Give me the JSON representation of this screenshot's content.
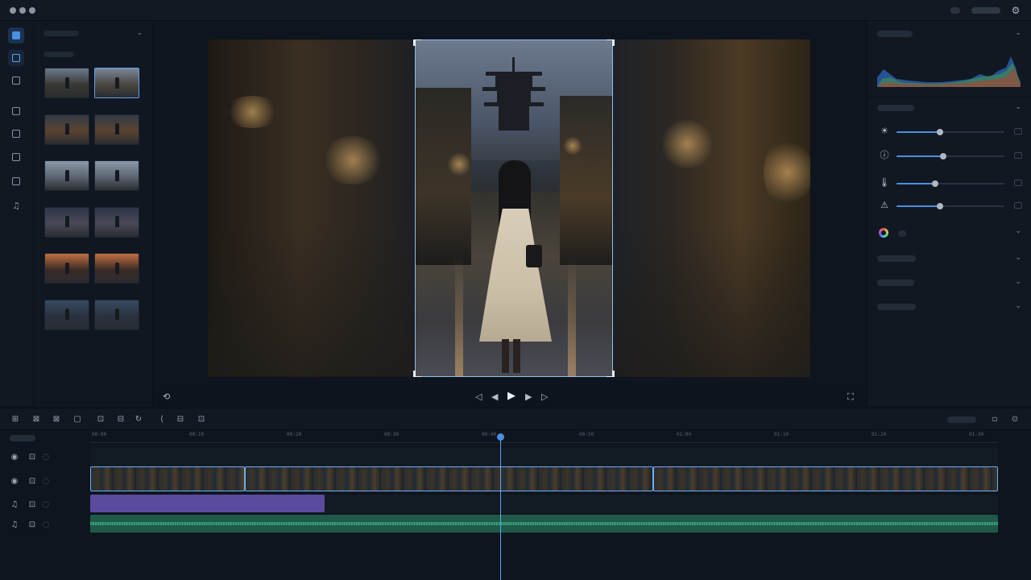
{
  "window": {
    "traffic_lights": [
      "close",
      "minimize",
      "maximize"
    ],
    "top_right_icon": "gear-icon"
  },
  "rail": {
    "items": [
      {
        "name": "media-icon",
        "active": true
      },
      {
        "name": "project-icon",
        "active": false
      },
      {
        "name": "text-icon",
        "active": false
      },
      {
        "name": "effects-icon",
        "active": false
      },
      {
        "name": "transitions-icon",
        "active": false
      },
      {
        "name": "stickers-icon",
        "active": false
      },
      {
        "name": "templates-icon",
        "active": false
      },
      {
        "name": "music-icon",
        "active": false
      }
    ]
  },
  "media_panel": {
    "thumbnails": [
      {
        "scene": "street-dusk",
        "selected": false
      },
      {
        "scene": "woman-walking",
        "selected": true
      },
      {
        "scene": "street-lights",
        "selected": false
      },
      {
        "scene": "street-lights",
        "selected": false
      },
      {
        "scene": "street-rain",
        "selected": false
      },
      {
        "scene": "street-rain",
        "selected": false
      },
      {
        "scene": "street-night",
        "selected": false
      },
      {
        "scene": "street-night",
        "selected": false
      },
      {
        "scene": "sunset-street",
        "selected": false
      },
      {
        "scene": "sunset-street",
        "selected": false
      },
      {
        "scene": "night-figure",
        "selected": false
      },
      {
        "scene": "night-figure",
        "selected": false
      }
    ]
  },
  "viewer": {
    "controls": {
      "prev_frame": "◁",
      "step_back": "◀",
      "play": "▶",
      "step_forward": "▶",
      "next_frame": "▷"
    }
  },
  "properties": {
    "sliders": [
      {
        "name": "brightness",
        "icon": "☀",
        "value": 0.4
      },
      {
        "name": "contrast",
        "icon": "ⓘ",
        "value": 0.43
      },
      {
        "name": "temperature",
        "icon": "🌡",
        "value": 0.36
      },
      {
        "name": "highlights",
        "icon": "⚠",
        "value": 0.4
      }
    ],
    "sections_collapsed": 4
  },
  "timeline": {
    "ruler_ticks": [
      "00:00",
      "00:10",
      "00:20",
      "00:30",
      "00:40",
      "00:50",
      "01:00",
      "01:10",
      "01:20",
      "01:30"
    ],
    "playhead_position": 0.451,
    "track_icons": [
      {
        "type": "eye-icon",
        "lock": "lock-icon"
      },
      {
        "type": "eye-icon",
        "lock": "lock-icon"
      },
      {
        "type": "music-icon",
        "lock": "lock-icon"
      },
      {
        "type": "music-icon",
        "lock": "lock-icon"
      }
    ],
    "video_clips": [
      {
        "start": 0.0,
        "end": 0.17,
        "selected": true
      },
      {
        "start": 0.17,
        "end": 0.62,
        "selected": true
      },
      {
        "start": 0.62,
        "end": 1.0,
        "selected": true
      }
    ],
    "audio_clips": [
      {
        "color": "#5c4a9e",
        "start": 0.0,
        "end": 0.26
      },
      {
        "color": "#1f5a48",
        "start": 0.0,
        "end": 1.0
      }
    ]
  },
  "colors": {
    "accent": "#4a90e2",
    "crop_border": "#8dbfef"
  }
}
